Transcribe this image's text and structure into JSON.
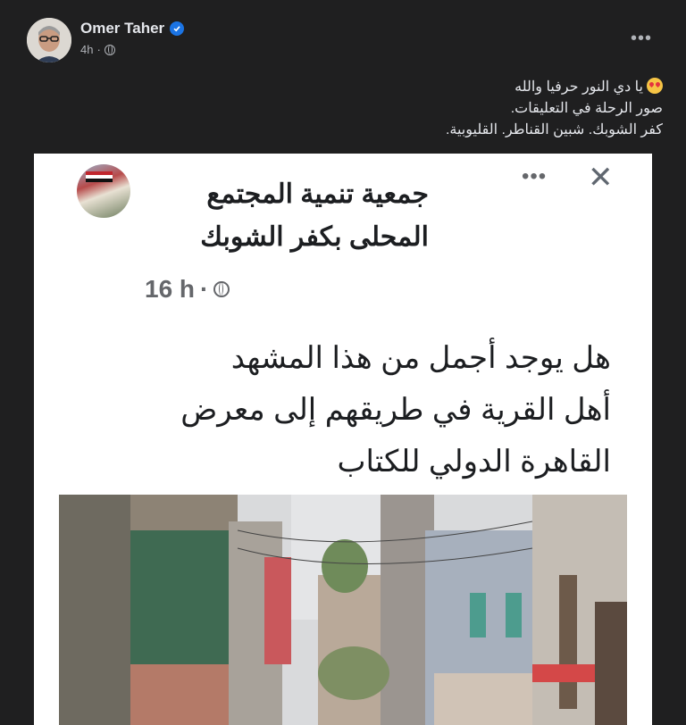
{
  "post": {
    "author": "Omer Taher",
    "time": "4h",
    "more_label": "•••",
    "text_lines": [
      "يا دي النور حرفيا والله",
      "صور الرحلة في التعليقات.",
      "كفر الشوبك. شبين القناطر. القليوبية."
    ]
  },
  "shared": {
    "title_lines": [
      "جمعية تنمية المجتمع",
      "المحلى بكفر الشوبك"
    ],
    "time": "16 h",
    "more_label": "•••",
    "close_label": "✕",
    "body_lines": [
      "هل يوجد أجمل من هذا المشهد",
      "أهل القرية في طريقهم إلى معرض",
      "القاهرة الدولي للكتاب"
    ]
  },
  "colors": {
    "background": "#1f1f20",
    "text": "#e4e6eb",
    "secondary": "#b0b3b8",
    "verified": "#1b74e4"
  },
  "icons": {
    "verified": "verified-badge-icon",
    "privacy": "globe-icon",
    "emoji": "heart-eyes-emoji-icon",
    "close": "close-icon",
    "more": "more-dots-icon"
  }
}
